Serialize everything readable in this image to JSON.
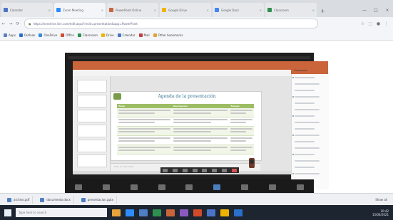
{
  "browser": {
    "tabs": [
      {
        "label": "Calendar",
        "color": "#4b73c7"
      },
      {
        "label": "Zoom Meeting",
        "color": "#2d8cff",
        "active": true
      },
      {
        "label": "PowerPoint Online",
        "color": "#c9643b"
      },
      {
        "label": "Google Drive",
        "color": "#f0b400"
      },
      {
        "label": "Google Docs",
        "color": "#4285f4"
      },
      {
        "label": "Classroom",
        "color": "#2f8f4f"
      }
    ],
    "new_tab": "+",
    "url": "https://onedrive.live.com/edit.aspx?resid=presentation&app=PowerPoint",
    "bookmarks": [
      {
        "label": "Apps",
        "color": "#5b7fc7"
      },
      {
        "label": "Outlook",
        "color": "#2a6fc9"
      },
      {
        "label": "OneDrive",
        "color": "#3a8ad6"
      },
      {
        "label": "Office",
        "color": "#d24a2a"
      },
      {
        "label": "Classroom",
        "color": "#2f8f4f"
      },
      {
        "label": "Drive",
        "color": "#f0b400"
      },
      {
        "label": "Calendar",
        "color": "#4b73c7"
      },
      {
        "label": "Mail",
        "color": "#c43d3d"
      },
      {
        "label": "Other bookmarks",
        "color": "#e0a43a"
      }
    ]
  },
  "presentation": {
    "slide_title": "Agenda de la presentación",
    "table_header": [
      "Tema",
      "Descripción",
      "Tiempo"
    ],
    "rows": [
      [
        "",
        "",
        ""
      ],
      [
        "",
        "",
        ""
      ],
      [
        "",
        "",
        ""
      ],
      [
        "",
        "",
        ""
      ],
      [
        "",
        "",
        ""
      ]
    ],
    "notes": "Click to add notes",
    "side_panel_title": "Comments"
  },
  "downloads": [
    "archivo.pdf",
    "documento.docx",
    "presentacion.pptx"
  ],
  "downloads_showall": "Show all",
  "taskbar": {
    "search_placeholder": "Type here to search",
    "apps": [
      "#e8a33d",
      "#2d8cff",
      "#4e7fc4",
      "#2f8f4f",
      "#c9643b",
      "#8a5ac2",
      "#d24a2a",
      "#4b73c7",
      "#f0b400",
      "#2a6fc9"
    ],
    "time": "10:42",
    "date": "15/06/2021"
  }
}
